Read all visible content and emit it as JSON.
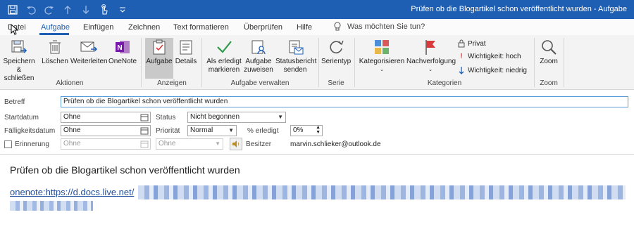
{
  "window": {
    "title": "Prüfen ob die Blogartikel schon veröffentlicht wurden  -  Aufgabe"
  },
  "quick_access": {
    "icons": [
      "save-icon",
      "undo-icon",
      "redo-icon",
      "up-icon",
      "down-icon",
      "touch-mode-icon",
      "customize-icon"
    ]
  },
  "tabs": [
    {
      "label": "Datei"
    },
    {
      "label": "Aufgabe",
      "active": true
    },
    {
      "label": "Einfügen"
    },
    {
      "label": "Zeichnen"
    },
    {
      "label": "Text formatieren"
    },
    {
      "label": "Überprüfen"
    },
    {
      "label": "Hilfe"
    }
  ],
  "tell_me": {
    "placeholder": "Was möchten Sie tun?"
  },
  "ribbon": {
    "groups": {
      "aktionen": "Aktionen",
      "anzeigen": "Anzeigen",
      "aufgabe_verwalten": "Aufgabe verwalten",
      "serie": "Serie",
      "kategorien": "Kategorien",
      "zoom": "Zoom"
    },
    "buttons": {
      "save_close_1": "Speichern",
      "save_close_2": "& schließen",
      "delete": "Löschen",
      "forward": "Weiterleiten",
      "onenote": "OneNote",
      "task": "Aufgabe",
      "details": "Details",
      "mark_complete_1": "Als erledigt",
      "mark_complete_2": "markieren",
      "assign_1": "Aufgabe",
      "assign_2": "zuweisen",
      "status_report_1": "Statusbericht",
      "status_report_2": "senden",
      "recurrence": "Serientyp",
      "categorize": "Kategorisieren",
      "follow_up": "Nachverfolgung",
      "private": "Privat",
      "importance_high": "Wichtigkeit: hoch",
      "importance_low": "Wichtigkeit: niedrig",
      "zoom": "Zoom"
    },
    "colors": {
      "accent": "#1e5fb4",
      "flag": "#d83b3b",
      "check": "#2e9a4a"
    }
  },
  "form": {
    "subject_label": "Betreff",
    "subject_value": "Prüfen ob die Blogartikel schon veröffentlicht wurden",
    "start_label": "Startdatum",
    "start_value": "Ohne",
    "status_label": "Status",
    "status_value": "Nicht begonnen",
    "due_label": "Fälligkeitsdatum",
    "due_value": "Ohne",
    "priority_label": "Priorität",
    "priority_value": "Normal",
    "percent_label": "% erledigt",
    "percent_value": "0%",
    "reminder_label": "Erinnerung",
    "reminder_date": "Ohne",
    "reminder_time": "Ohne",
    "owner_label": "Besitzer",
    "owner_value": "marvin.schlieker@outlook.de"
  },
  "body": {
    "title": "Prüfen ob die Blogartikel schon veröffentlicht wurden",
    "link_prefix": "onenote:https://d.docs.live.net/"
  }
}
